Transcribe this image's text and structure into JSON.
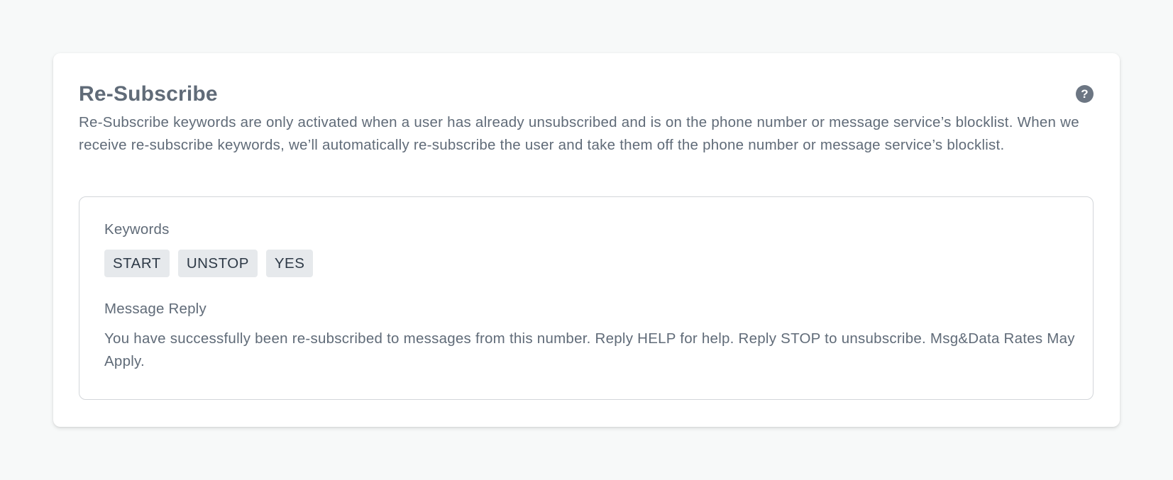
{
  "card": {
    "title": "Re-Subscribe",
    "help_icon": "?",
    "description": "Re-Subscribe keywords are only activated when a user has already unsubscribed and is on the phone number or message service’s blocklist. When we receive re-subscribe keywords, we’ll automatically re-subscribe the user and take them off the phone number or message service’s blocklist."
  },
  "keywords": {
    "label": "Keywords",
    "items": [
      "START",
      "UNSTOP",
      "YES"
    ]
  },
  "message_reply": {
    "label": "Message Reply",
    "text": "You have successfully been re-subscribed to messages from this number. Reply HELP for help. Reply STOP to unsubscribe. Msg&Data Rates May Apply."
  },
  "icons": {
    "help": "question-circle-icon"
  },
  "colors": {
    "page_background": "#f7f9f9",
    "card_background": "#ffffff",
    "text": "#606b78",
    "chip_background": "#e6e9ec",
    "chip_text": "#2e3a47",
    "border": "#d3d6da",
    "help_icon": "#6c7683"
  }
}
